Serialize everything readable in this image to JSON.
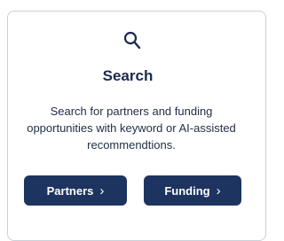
{
  "card": {
    "title": "Search",
    "description": "Search for partners and funding opportunities with keyword or AI-assisted recommendtions.",
    "icon": "search-icon"
  },
  "buttons": [
    {
      "label": "Partners",
      "icon": "chevron-right-icon"
    },
    {
      "label": "Funding",
      "icon": "chevron-right-icon"
    }
  ],
  "colors": {
    "button_bg": "#1d3461",
    "title_text": "#1b2b4b",
    "border": "#c9d0d9"
  }
}
